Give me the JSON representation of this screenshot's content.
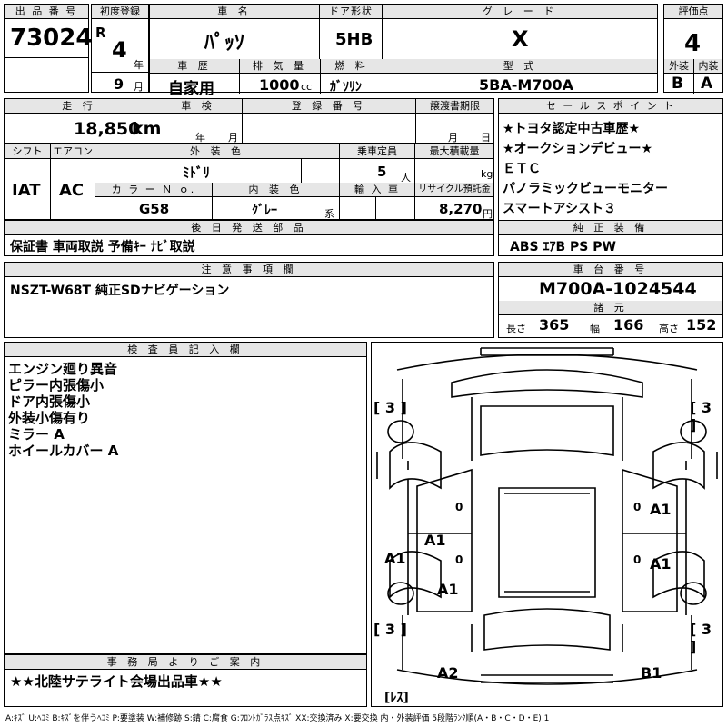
{
  "headers": {
    "lot_number": "出 品 番 号",
    "first_reg": "初度登録",
    "car_name": "車 名",
    "door_type": "ドア形状",
    "grade": "グ レ ー ド",
    "score": "評価点",
    "history": "車 歴",
    "displacement": "排 気 量",
    "fuel": "燃 料",
    "model_type": "型 式",
    "exterior": "外装",
    "interior": "内装",
    "mileage": "走 行",
    "inspection": "車 検",
    "registration_no": "登 録 番 号",
    "transfer_deadline": "譲渡書期限",
    "sales_point": "セ ー ル ス ポ イ ン ト",
    "shift": "シフト",
    "aircon": "エアコン",
    "exterior_color": "外 装 色",
    "capacity": "乗車定員",
    "max_load": "最大積載量",
    "color_no": "カ ラ ー Ｎ ｏ.",
    "interior_color": "内 装 色",
    "import": "輸 入 車",
    "recycle": "リサイクル預託金",
    "later_parts": "後 日 発 送 部 品",
    "genuine_equip": "純 正 装 備",
    "notes": "注 意 事 項 欄",
    "chassis_no": "車 台 番 号",
    "dimensions": "諸 元",
    "inspector": "検 査 員 記 入 欄",
    "office_info": "事 務 局 よ り ご 案 内"
  },
  "lot_number": "73024",
  "era": "R",
  "reg_year": "4",
  "reg_year_unit": "年",
  "reg_month": "9",
  "reg_month_unit": "月",
  "car_name": "ﾊﾟｯｿ",
  "door_type": "5HB",
  "grade": "X",
  "score": "4",
  "history": "自家用",
  "displacement": "1000",
  "displacement_unit": "cc",
  "fuel": "ｶﾞｿﾘﾝ",
  "model_type": "5BA-M700A",
  "exterior_grade": "B",
  "interior_grade": "A",
  "mileage": "18,850",
  "mileage_unit": "km",
  "inspection_year_unit": "年",
  "inspection_month_unit": "月",
  "transfer_month_unit": "月",
  "transfer_day_unit": "日",
  "sales_points": [
    "★トヨタ認定中古車歴★",
    "★オークションデビュー★",
    "ＥＴＣ",
    "パノラミックビューモニター",
    "スマートアシスト３"
  ],
  "shift": "IAT",
  "aircon": "AC",
  "exterior_color": "ﾐﾄﾞﾘ",
  "capacity": "5",
  "capacity_unit": "人",
  "max_load_unit": "kg",
  "color_no": "G58",
  "interior_color": "ｸﾞﾚｰ",
  "interior_color_unit": "系",
  "recycle": "8,270",
  "recycle_unit": "円",
  "later_parts": "保証書  車両取説  予備ｷｰ  ﾅﾋﾞ取説",
  "genuine_equip": "ABS  ｴｱB  PS  PW",
  "notes": "NSZT-W68T  純正SDナビゲーション",
  "chassis_no": "M700A-1024544",
  "dim_length_label": "長さ",
  "dim_length": "365",
  "dim_width_label": "幅",
  "dim_width": "166",
  "dim_height_label": "高さ",
  "dim_height": "152",
  "inspector_lines": [
    "エンジン廻り異音",
    "ピラー内張傷小",
    "ドア内張傷小",
    "外装小傷有り",
    "ミラー A",
    "ホイールカバー A"
  ],
  "office_info": "★★北陸サテライト会場出品車★★",
  "diagram": {
    "tire_fl": "[ 3 ]",
    "tire_fr": "[ 3 ]",
    "tire_rl": "[ 3 ]",
    "tire_rr": "[ 3 ]",
    "spare": "[ﾚｽ]",
    "mark_a1_rf_door": "A1",
    "mark_a1_rr_door": "A1",
    "mark_a1_l_front_door": "A1",
    "mark_a1_l_fender": "A1",
    "mark_a1_l_rear": "A1",
    "mark_a2": "A2",
    "mark_b1": "B1",
    "zero_1": "0",
    "zero_2": "0",
    "zero_3": "0",
    "zero_4": "0"
  },
  "legend": "A:ｷｽﾞ U:ﾍｺﾐ B:ｷｽﾞを伴うﾍｺﾐ P:要塗装 W:補修跡 S:錆 C:腐食 G:ﾌﾛﾝﾄｶﾞﾗｽ点ｷｽﾞ XX:交換済み X:要交換  内・外装評価  5段階ﾗﾝｸ順(A・B・C・D・E) 1"
}
